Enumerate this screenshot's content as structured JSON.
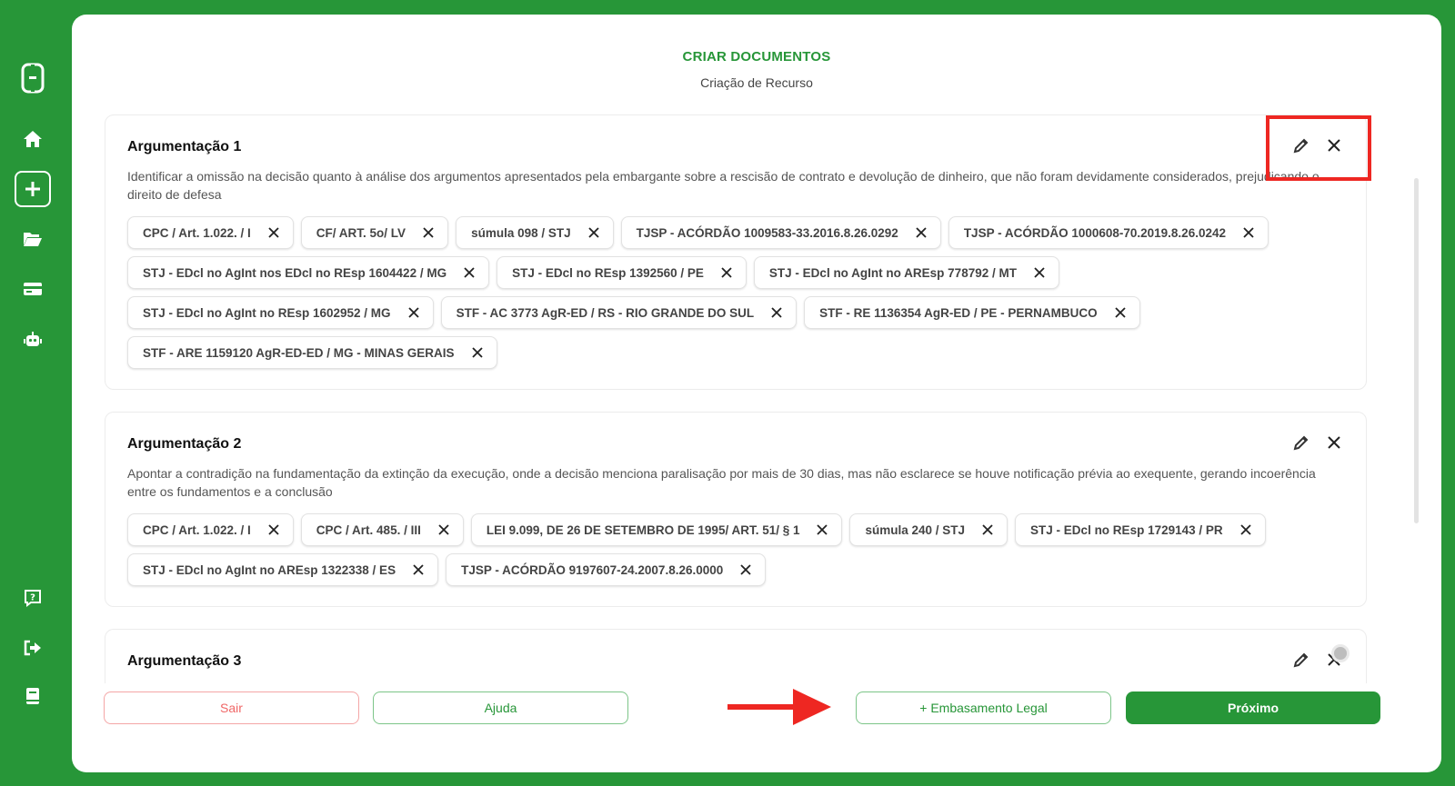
{
  "app": {
    "accent_color": "#279638",
    "annotation_color": "#ee2722"
  },
  "sidebar": {
    "items": [
      {
        "icon": "app-logo-icon"
      },
      {
        "icon": "home-icon"
      },
      {
        "icon": "add-icon"
      },
      {
        "icon": "folder-icon"
      },
      {
        "icon": "credit-card-icon"
      },
      {
        "icon": "robot-icon"
      },
      {
        "icon": "help-icon"
      },
      {
        "icon": "logout-icon"
      },
      {
        "icon": "book-icon"
      }
    ]
  },
  "header": {
    "title": "CRIAR DOCUMENTOS",
    "subtitle": "Criação de Recurso"
  },
  "arguments": [
    {
      "title": "Argumentação 1",
      "description": "Identificar a omissão na decisão quanto à análise dos argumentos apresentados pela embargante sobre a rescisão de contrato e devolução de dinheiro, que não foram devidamente considerados, prejudicando o direito de defesa",
      "chips": [
        "CPC / Art. 1.022. / I",
        "CF/ ART. 5o/ LV",
        "súmula 098 / STJ",
        "TJSP - ACÓRDÃO 1009583-33.2016.8.26.0292",
        "TJSP - ACÓRDÃO 1000608-70.2019.8.26.0242",
        "STJ - EDcl no AgInt nos EDcl no REsp 1604422 / MG",
        "STJ - EDcl no REsp 1392560 / PE",
        "STJ - EDcl no AgInt no AREsp 778792 / MT",
        "STJ - EDcl no AgInt no REsp 1602952 / MG",
        "STF - AC 3773 AgR-ED / RS - RIO GRANDE DO SUL",
        "STF - RE 1136354 AgR-ED / PE - PERNAMBUCO",
        "STF - ARE 1159120 AgR-ED-ED / MG - MINAS GERAIS"
      ]
    },
    {
      "title": "Argumentação 2",
      "description": "Apontar a contradição na fundamentação da extinção da execução, onde a decisão menciona paralisação por mais de 30 dias, mas não esclarece se houve notificação prévia ao exequente, gerando incoerência entre os fundamentos e a conclusão",
      "chips": [
        "CPC / Art. 1.022. / I",
        "CPC / Art. 485. / III",
        "LEI 9.099, DE 26 DE SETEMBRO DE 1995/ ART. 51/ § 1",
        "súmula 240 / STJ",
        "STJ - EDcl no REsp 1729143 / PR",
        "STJ - EDcl no AgInt no AREsp 1322338 / ES",
        "TJSP - ACÓRDÃO 9197607-24.2007.8.26.0000"
      ]
    },
    {
      "title": "Argumentação 3",
      "description": "",
      "chips": []
    }
  ],
  "footer": {
    "exit_label": "Sair",
    "help_label": "Ajuda",
    "legal_basis_label": "+ Embasamento Legal",
    "next_label": "Próximo"
  }
}
